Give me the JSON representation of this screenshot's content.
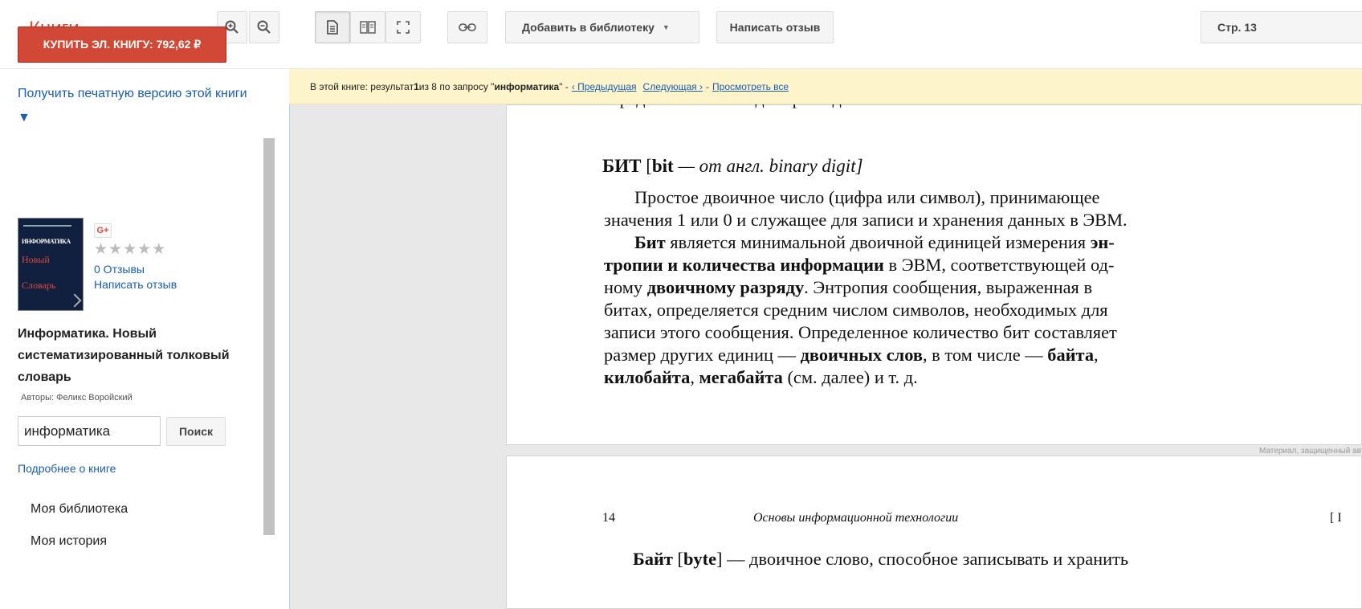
{
  "app": {
    "logo": "Книги"
  },
  "toolbar": {
    "add_library_label": "Добавить в библиотеку",
    "review_label": "Написать отзыв",
    "page_label": "Стр. 13"
  },
  "sidebar": {
    "buy_label": "КУПИТЬ ЭЛ. КНИГУ: 792,62 ₽",
    "print_link": "Получить печатную версию этой книги ▼",
    "cover": {
      "line1": "ИНФОРМАТИКА",
      "line2": "Новый",
      "line3": "Словарь"
    },
    "gplus": "G+",
    "stars": "★★★★★",
    "reviews_count": "0 Отзывы",
    "write_review": "Написать отзыв",
    "book_title": "Информатика. Новый систематизированный толковый словарь",
    "authors": "Авторы: Феликс Воройский",
    "search_value": "информатика",
    "search_button": "Поиск",
    "more_link": "Подробнее о книге",
    "nav": [
      "Моя библиотека",
      "Моя история"
    ]
  },
  "infobar": {
    "prefix": "В этой книге: результат ",
    "num": "1",
    "mid": " из 8 по запросу \"",
    "query": "информатика",
    "suffix": "\" - ",
    "prev": "‹ Предыдущая",
    "next": "Следующая ›",
    "dash": " - ",
    "all": "Просмотреть все"
  },
  "page1": {
    "cut_text": "представление в виде строки двоичных битов.",
    "heading_bold": "БИТ",
    "heading_rest1": " [",
    "heading_bit": "bit",
    "heading_rest2": " — от англ. binary digit]",
    "para1_l1": "Простое двоичное число (цифра или символ), принимающее",
    "para1_l2": "значения 1 или 0 и служащее для записи и хранения данных в ЭВМ.",
    "l3_b1": "Бит",
    "l3_t": " является минимальной двоичной единицей измерения ",
    "l3_b2": "эн-",
    "l4_b": "тропии и количества информации",
    "l4_t": " в ЭВМ, соответствующей од-",
    "l5_t1": "ному ",
    "l5_b": "двоичному разряду",
    "l5_t2": ". Энтропия сообщения, выраженная в",
    "l6": "битах, определяется средним числом символов, необходимых для",
    "l7": "записи этого сообщения. Определенное количество бит составляет",
    "l8_t1": "размер других единиц — ",
    "l8_b1": "двоичных слов",
    "l8_t2": ", в том числе — ",
    "l8_b2": "байта",
    "l8_t3": ",",
    "l9_b1": "килобайта",
    "l9_t1": ", ",
    "l9_b2": "мегабайта",
    "l9_t2": " (см. далее) и т. д.",
    "watermark": "Материал, защищенный авторским правом"
  },
  "page2": {
    "page_num": "14",
    "runhead": "Основы информационной технологии",
    "bracket": "[ I",
    "first_b": "Байт",
    "first_t1": " [",
    "first_b2": "byte",
    "first_t2": "] — двоичное слово, способное записывать и хранить"
  }
}
